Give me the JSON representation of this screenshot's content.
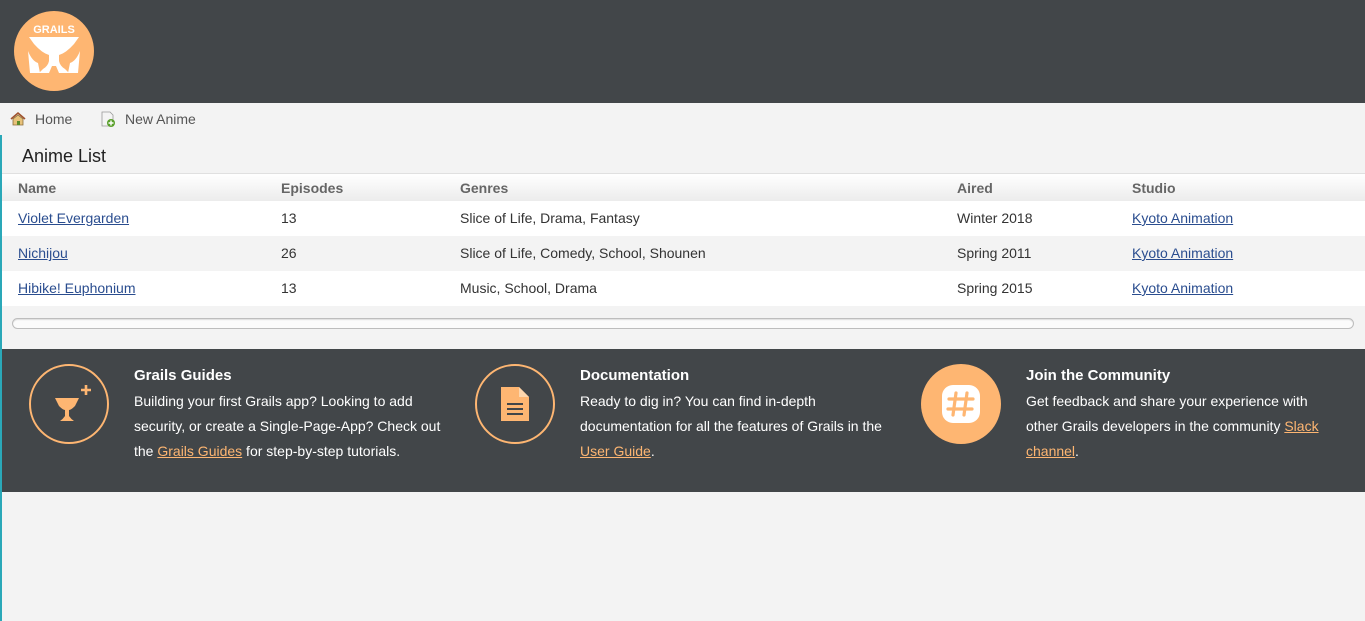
{
  "brand": {
    "logo_text": "GRAILS",
    "accent": "#feb672",
    "dark": "#424649"
  },
  "nav": {
    "home": {
      "label": "Home",
      "icon": "home-icon"
    },
    "new": {
      "label": "New Anime",
      "icon": "new-document-icon"
    }
  },
  "page": {
    "title": "Anime List"
  },
  "table": {
    "headers": {
      "name": "Name",
      "episodes": "Episodes",
      "genres": "Genres",
      "aired": "Aired",
      "studio": "Studio"
    },
    "rows": [
      {
        "name": "Violet Evergarden",
        "episodes": "13",
        "genres": "Slice of Life, Drama, Fantasy",
        "aired": "Winter 2018",
        "studio": "Kyoto Animation"
      },
      {
        "name": "Nichijou",
        "episodes": "26",
        "genres": "Slice of Life, Comedy, School, Shounen",
        "aired": "Spring 2011",
        "studio": "Kyoto Animation"
      },
      {
        "name": "Hibike! Euphonium",
        "episodes": "13",
        "genres": "Music, School, Drama",
        "aired": "Spring 2015",
        "studio": "Kyoto Animation"
      }
    ]
  },
  "footer": {
    "guides": {
      "title": "Grails Guides",
      "text_before": "Building your first Grails app? Looking to add security, or create a Single-Page-App? Check out the ",
      "link": "Grails Guides",
      "text_after": " for step-by-step tutorials.",
      "icon": "grails-cup-plus-icon"
    },
    "docs": {
      "title": "Documentation",
      "text_before": "Ready to dig in? You can find in-depth documentation for all the features of Grails in the ",
      "link": "User Guide",
      "text_after": ".",
      "icon": "document-icon"
    },
    "community": {
      "title": "Join the Community",
      "text_before": "Get feedback and share your experience with other Grails developers in the community ",
      "link": "Slack channel",
      "text_after": ".",
      "icon": "slack-hash-icon"
    }
  }
}
